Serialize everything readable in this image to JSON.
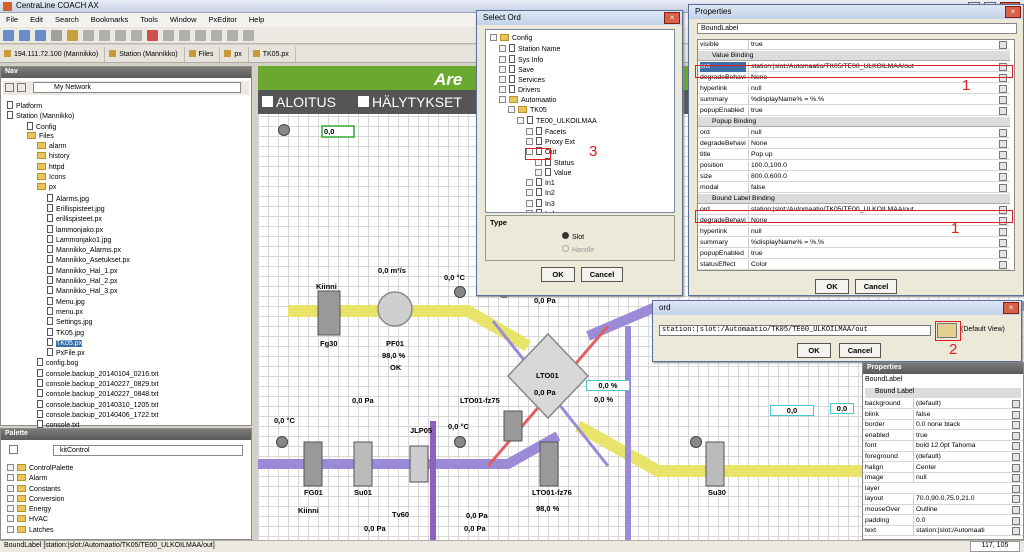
{
  "app": {
    "title": "CentraLine COACH AX"
  },
  "menu": [
    "File",
    "Edit",
    "Search",
    "Bookmarks",
    "Tools",
    "Window",
    "PxEditor",
    "Help"
  ],
  "tabs": [
    "194.111.72.100 (Mannikko)",
    "Station (Mannikko)",
    "Files",
    "px",
    "TK05.px"
  ],
  "nav": {
    "title": "Nav",
    "network": "My Network",
    "tree": [
      "Platform",
      "Station (Mannikko)",
      "Config",
      "Files",
      "alarm",
      "history",
      "httpd",
      "Icons",
      "px",
      "Alarms.jpg",
      "Erillispisteet.jpg",
      "erillispisteet.px",
      "lammonjako.px",
      "Lammonjako1.jpg",
      "Mannikko_Alarms.px",
      "Mannikko_Asetukset.px",
      "Mannikko_Hal_1.px",
      "Mannikko_Hal_2.px",
      "Mannikko_Hal_3.px",
      "Menu.jpg",
      "menu.px",
      "Settings.jpg",
      "TK05.jpg",
      "TK05.px",
      "PxFile.px",
      "config.bog",
      "console.backup_20140104_0216.txt",
      "console.backup_20140227_0829.txt",
      "console.backup_20140227_0848.txt",
      "console.backup_20140310_1205.txt",
      "console.backup_20140406_1722.txt",
      "console.txt"
    ]
  },
  "palette": {
    "title": "Palette",
    "module": "kitControl",
    "items": [
      "ControlPalette",
      "Alarm",
      "Constants",
      "Conversion",
      "Energy",
      "HVAC",
      "Latches"
    ]
  },
  "canvas": {
    "logo": "Are",
    "nav_home": "ALOITUS",
    "nav_alarms": "HÄLYTYKSET",
    "labels": [
      "0,0",
      "Kiinni",
      "Fg30",
      "PF01",
      "98,0 %",
      "OK",
      "0,0 m³/s",
      "0,0 °C",
      "0,0 Pa",
      "0,0 Pa",
      "LTO01",
      "0,0 %",
      "0,0 %",
      "LTO01-fz75",
      "0,0 °C",
      "0,0 °C",
      "0,0 Pa",
      "JLP05",
      "FG01",
      "Su01",
      "Kiinni",
      "Tv60",
      "0,0 Pa",
      "LTO01-fz76",
      "98,0 %",
      "Su30",
      "0,0",
      "0,0",
      "0,0 Pa",
      "0,0 Pa"
    ]
  },
  "select_ord": {
    "title": "Select Ord",
    "tree": [
      "Config",
      "Station Name",
      "Sys Info",
      "Save",
      "Services",
      "Drivers",
      "Automaatio",
      "TK05",
      "TE00_ULKOILMAA",
      "Facets",
      "Proxy Ext",
      "Out",
      "Status",
      "Value",
      "In1",
      "In2",
      "In3",
      "In4"
    ],
    "type_label": "Type",
    "opt_slot": "Slot",
    "opt_handle": "Handle",
    "ok": "OK",
    "cancel": "Cancel"
  },
  "properties_top": {
    "title": "Properties",
    "component": "BoundLabel",
    "rows": [
      {
        "t": "row",
        "k": "visible",
        "v": "true"
      },
      {
        "t": "sec",
        "k": "Value Binding"
      },
      {
        "t": "row",
        "k": "ord",
        "v": "station:|slot:/Automaatio/TK05/TE00_ULKOILMAA/out",
        "sel": true
      },
      {
        "t": "row",
        "k": "degradeBehavi",
        "v": "None"
      },
      {
        "t": "row",
        "k": "hyperlink",
        "v": "null"
      },
      {
        "t": "row",
        "k": "summary",
        "v": "%displayName% = %.%"
      },
      {
        "t": "row",
        "k": "popupEnabled",
        "v": "true"
      },
      {
        "t": "sec",
        "k": "Popup Binding"
      },
      {
        "t": "row",
        "k": "ord",
        "v": "null"
      },
      {
        "t": "row",
        "k": "degradeBehavi",
        "v": "None"
      },
      {
        "t": "row",
        "k": "title",
        "v": "Pop up"
      },
      {
        "t": "row",
        "k": "position",
        "v": "100.0,100.0"
      },
      {
        "t": "row",
        "k": "size",
        "v": "800.0,600.0"
      },
      {
        "t": "row",
        "k": "modal",
        "v": "false"
      },
      {
        "t": "sec",
        "k": "Bound Label Binding"
      },
      {
        "t": "row",
        "k": "ord",
        "v": "station:|slot:/Automaatio/TK05/TE00_ULKOILMAA/out"
      },
      {
        "t": "row",
        "k": "degradeBehavi",
        "v": "None"
      },
      {
        "t": "row",
        "k": "hyperlink",
        "v": "null"
      },
      {
        "t": "row",
        "k": "summary",
        "v": "%displayName% = %.%"
      },
      {
        "t": "row",
        "k": "popupEnabled",
        "v": "true"
      },
      {
        "t": "row",
        "k": "statusEffect",
        "v": "Color"
      }
    ],
    "ok": "OK",
    "cancel": "Cancel"
  },
  "ord_dialog": {
    "title": "ord",
    "value": "station:|slot:/Automaatio/TK05/TE00_ULKOILMAA/out",
    "view": "(Default View)",
    "ok": "OK",
    "cancel": "Cancel"
  },
  "properties_bottom": {
    "title": "Properties",
    "component": "BoundLabel",
    "section": "Bound Label",
    "rows": [
      {
        "k": "background",
        "v": "(default)"
      },
      {
        "k": "blink",
        "v": "false"
      },
      {
        "k": "border",
        "v": "0.0 none black"
      },
      {
        "k": "enabled",
        "v": "true"
      },
      {
        "k": "font",
        "v": "bold 12.0pt Tahoma"
      },
      {
        "k": "foreground",
        "v": "(default)"
      },
      {
        "k": "halign",
        "v": "Center"
      },
      {
        "k": "image",
        "v": "null"
      },
      {
        "k": "layer",
        "v": ""
      },
      {
        "k": "layout",
        "v": "70.0,90.0,75.0,21.0"
      },
      {
        "k": "mouseOver",
        "v": "Outline"
      },
      {
        "k": "padding",
        "v": "0.0"
      },
      {
        "k": "text",
        "v": "station:|slot:/Automaati"
      }
    ]
  },
  "annotations": [
    "1",
    "1",
    "2",
    "3"
  ],
  "status": {
    "text": "BoundLabel [station:|slot:/Automaatio/TK05/TE00_ULKOILMAA/out]",
    "coords": "117, 105"
  },
  "colors": {
    "accent": "#e02020",
    "duct_yellow": "#e8e46a",
    "duct_purple": "#9a8ad8"
  }
}
